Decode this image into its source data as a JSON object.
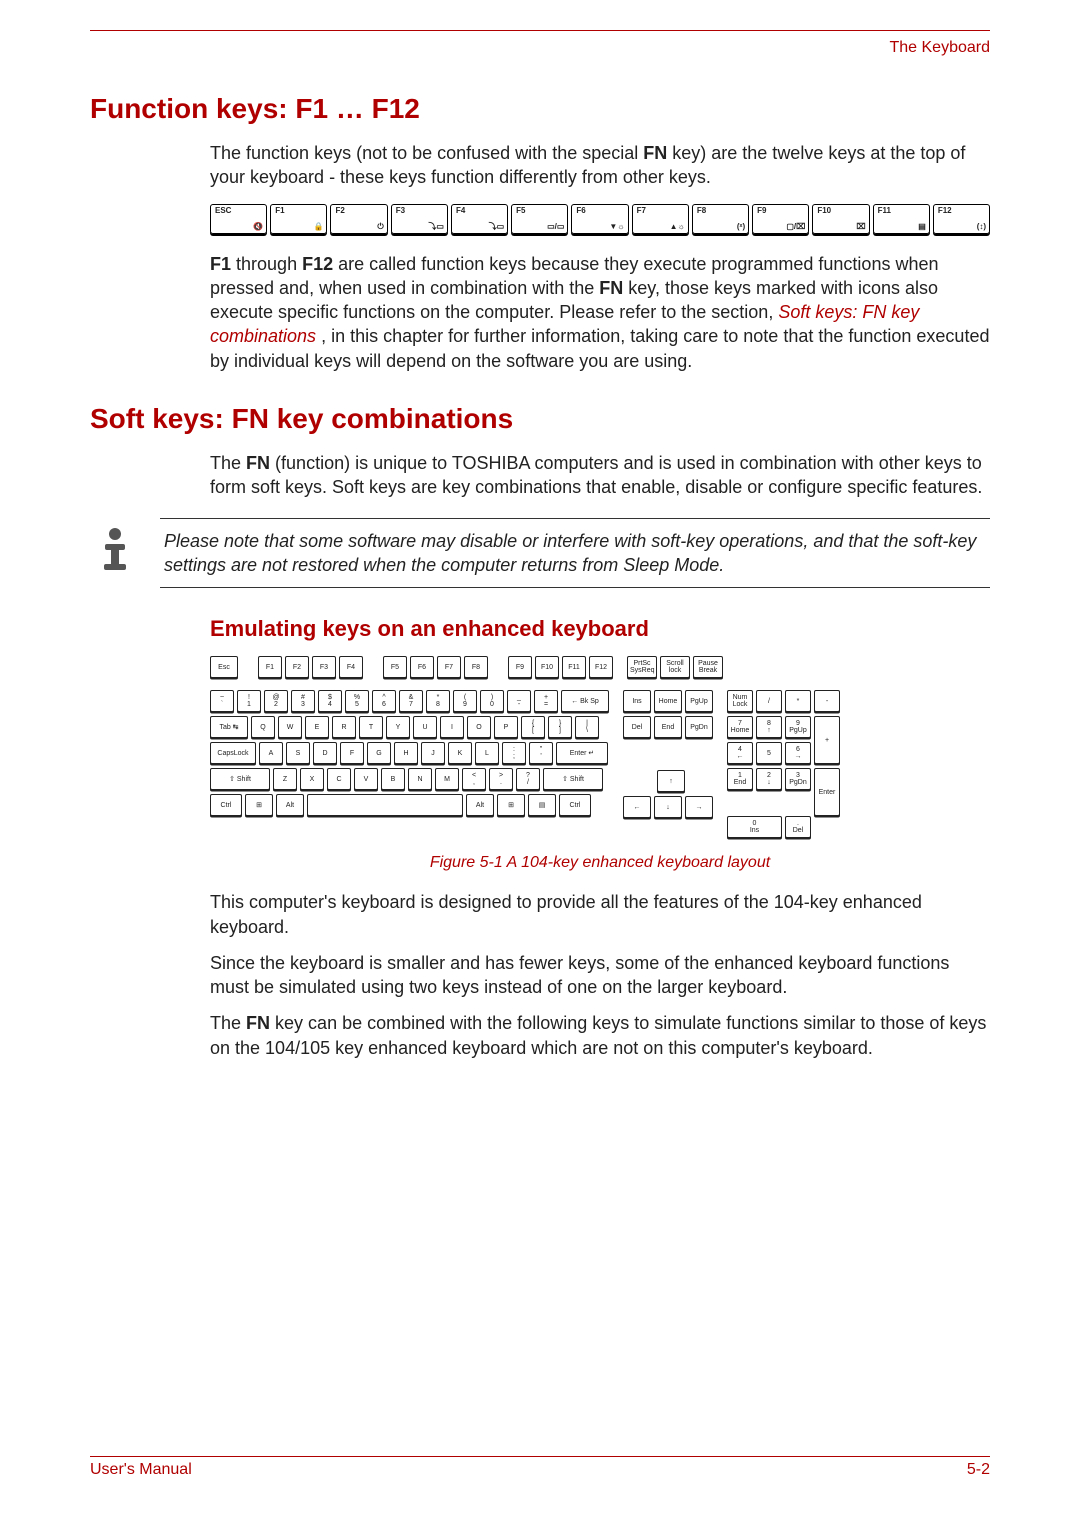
{
  "header": {
    "right_label": "The Keyboard"
  },
  "section1": {
    "title": "Function keys: F1 … F12",
    "p1_before_bold": "The function keys (not to be confused with the special ",
    "p1_bold": "FN",
    "p1_after_bold": " key) are the twelve keys at the top of your keyboard - these keys function differently from other keys.",
    "fkey_row": [
      {
        "label": "ESC",
        "glyph": "🔇"
      },
      {
        "label": "F1",
        "glyph": "🔒"
      },
      {
        "label": "F2",
        "glyph": "⏻"
      },
      {
        "label": "F3",
        "glyph": "⤵▭"
      },
      {
        "label": "F4",
        "glyph": "⤵▭"
      },
      {
        "label": "F5",
        "glyph": "▭/▭"
      },
      {
        "label": "F6",
        "glyph": "▼☼"
      },
      {
        "label": "F7",
        "glyph": "▲☼"
      },
      {
        "label": "F8",
        "glyph": "(ˣ)"
      },
      {
        "label": "F9",
        "glyph": "▢/⌧"
      },
      {
        "label": "F10",
        "glyph": "⌧"
      },
      {
        "label": "F11",
        "glyph": "▤"
      },
      {
        "label": "F12",
        "glyph": "(↕)"
      }
    ],
    "p2_a": "F1",
    "p2_b": " through ",
    "p2_c": "F12",
    "p2_d": " are called function keys because they execute programmed functions when pressed and, when used in combination with the ",
    "p2_e": "FN",
    "p2_f": " key, those keys marked with icons also execute specific functions on the computer. Please refer to the section, ",
    "p2_link": "Soft keys: FN key combinations",
    "p2_g": ", in this chapter for further information, taking care to note that the function executed by individual keys will depend on the software you are using."
  },
  "section2": {
    "title": "Soft keys: FN key combinations",
    "p1_a": "The ",
    "p1_b": "FN",
    "p1_c": " (function) is unique to TOSHIBA computers and is used in combination with other keys to form soft keys. Soft keys are key combinations that enable, disable or configure specific features.",
    "note": "Please note that some software may disable or interfere with soft-key operations, and that the soft-key settings are not restored when the computer returns from Sleep Mode.",
    "sub1_title": "Emulating keys on an enhanced keyboard",
    "kb104": {
      "func_row_main": [
        "Esc",
        "F1",
        "F2",
        "F3",
        "F4",
        "F5",
        "F6",
        "F7",
        "F8",
        "F9",
        "F10",
        "F11",
        "F12"
      ],
      "func_row_right": [
        "PrtSc\nSysReq",
        "Scroll\nlock",
        "Pause\nBreak"
      ],
      "num_row": [
        "~\n`",
        "!\n1",
        "@\n2",
        "#\n3",
        "$\n4",
        "%\n5",
        "^\n6",
        "&\n7",
        "*\n8",
        "(\n9",
        ")\n0",
        "_\n-",
        "+\n=",
        "← Bk Sp"
      ],
      "qwerty_row": [
        "Tab ↹",
        "Q",
        "W",
        "E",
        "R",
        "T",
        "Y",
        "U",
        "I",
        "O",
        "P",
        "{\n[",
        "}\n]",
        "|\n\\"
      ],
      "asdf_row": [
        "CapsLock",
        "A",
        "S",
        "D",
        "F",
        "G",
        "H",
        "J",
        "K",
        "L",
        ":\n;",
        "\"\n'",
        "Enter ↵"
      ],
      "zxcv_row": [
        "⇧ Shift",
        "Z",
        "X",
        "C",
        "V",
        "B",
        "N",
        "M",
        "<\n,",
        ">\n.",
        "?\n/",
        "⇧ Shift"
      ],
      "bottom_row": [
        "Ctrl",
        "⊞",
        "Alt",
        " ",
        "Alt",
        "⊞",
        "▤",
        "Ctrl"
      ],
      "nav_top": [
        "Ins",
        "Home",
        "PgUp"
      ],
      "nav_bottom": [
        "Del",
        "End",
        "PgDn"
      ],
      "arrows": {
        "up": "↑",
        "left": "←",
        "down": "↓",
        "right": "→"
      },
      "numpad": {
        "r1": [
          "Num\nLock",
          "/",
          "*",
          "-"
        ],
        "r2": [
          "7\nHome",
          "8\n↑",
          "9\nPgUp"
        ],
        "r3": [
          "4\n←",
          "5",
          "6\n→"
        ],
        "r4": [
          "1\nEnd",
          "2\n↓",
          "3\nPgDn"
        ],
        "r5": [
          "0\nIns",
          ".\nDel"
        ],
        "plus": "+",
        "enter": "Enter"
      }
    },
    "caption": "Figure 5-1 A 104-key enhanced keyboard layout",
    "p2": "This computer's keyboard is designed to provide all the features of the 104-key enhanced keyboard.",
    "p3": "Since the keyboard is smaller and has fewer keys, some of the enhanced keyboard functions must be simulated using two keys instead of one on the larger keyboard.",
    "p4_a": "The ",
    "p4_b": "FN",
    "p4_c": " key can be combined with the following keys to simulate functions similar to those of keys on the 104/105 key enhanced keyboard which are not on this computer's keyboard."
  },
  "footer": {
    "left": "User's Manual",
    "right": "5-2"
  }
}
